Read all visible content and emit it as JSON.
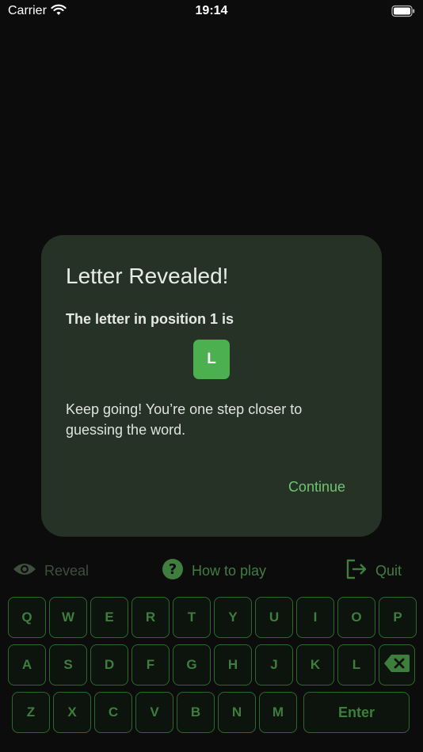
{
  "status_bar": {
    "carrier": "Carrier",
    "time": "19:14"
  },
  "actions": {
    "reveal": "Reveal",
    "how_to_play": "How to play",
    "quit": "Quit"
  },
  "keyboard": {
    "row1": [
      "Q",
      "W",
      "E",
      "R",
      "T",
      "Y",
      "U",
      "I",
      "O",
      "P"
    ],
    "row2": [
      "A",
      "S",
      "D",
      "F",
      "G",
      "H",
      "J",
      "K",
      "L"
    ],
    "row3": [
      "Z",
      "X",
      "C",
      "V",
      "B",
      "N",
      "M"
    ],
    "enter": "Enter"
  },
  "dialog": {
    "title": "Letter Revealed!",
    "subtitle": "The letter in position 1 is",
    "letter": "L",
    "body": "Keep going! You’re one step closer to guessing the word.",
    "continue": "Continue"
  },
  "colors": {
    "background": "#0b0c0b",
    "dialog": "#273227",
    "accent": "#4caf50",
    "key_border": "#2c6a2c"
  }
}
